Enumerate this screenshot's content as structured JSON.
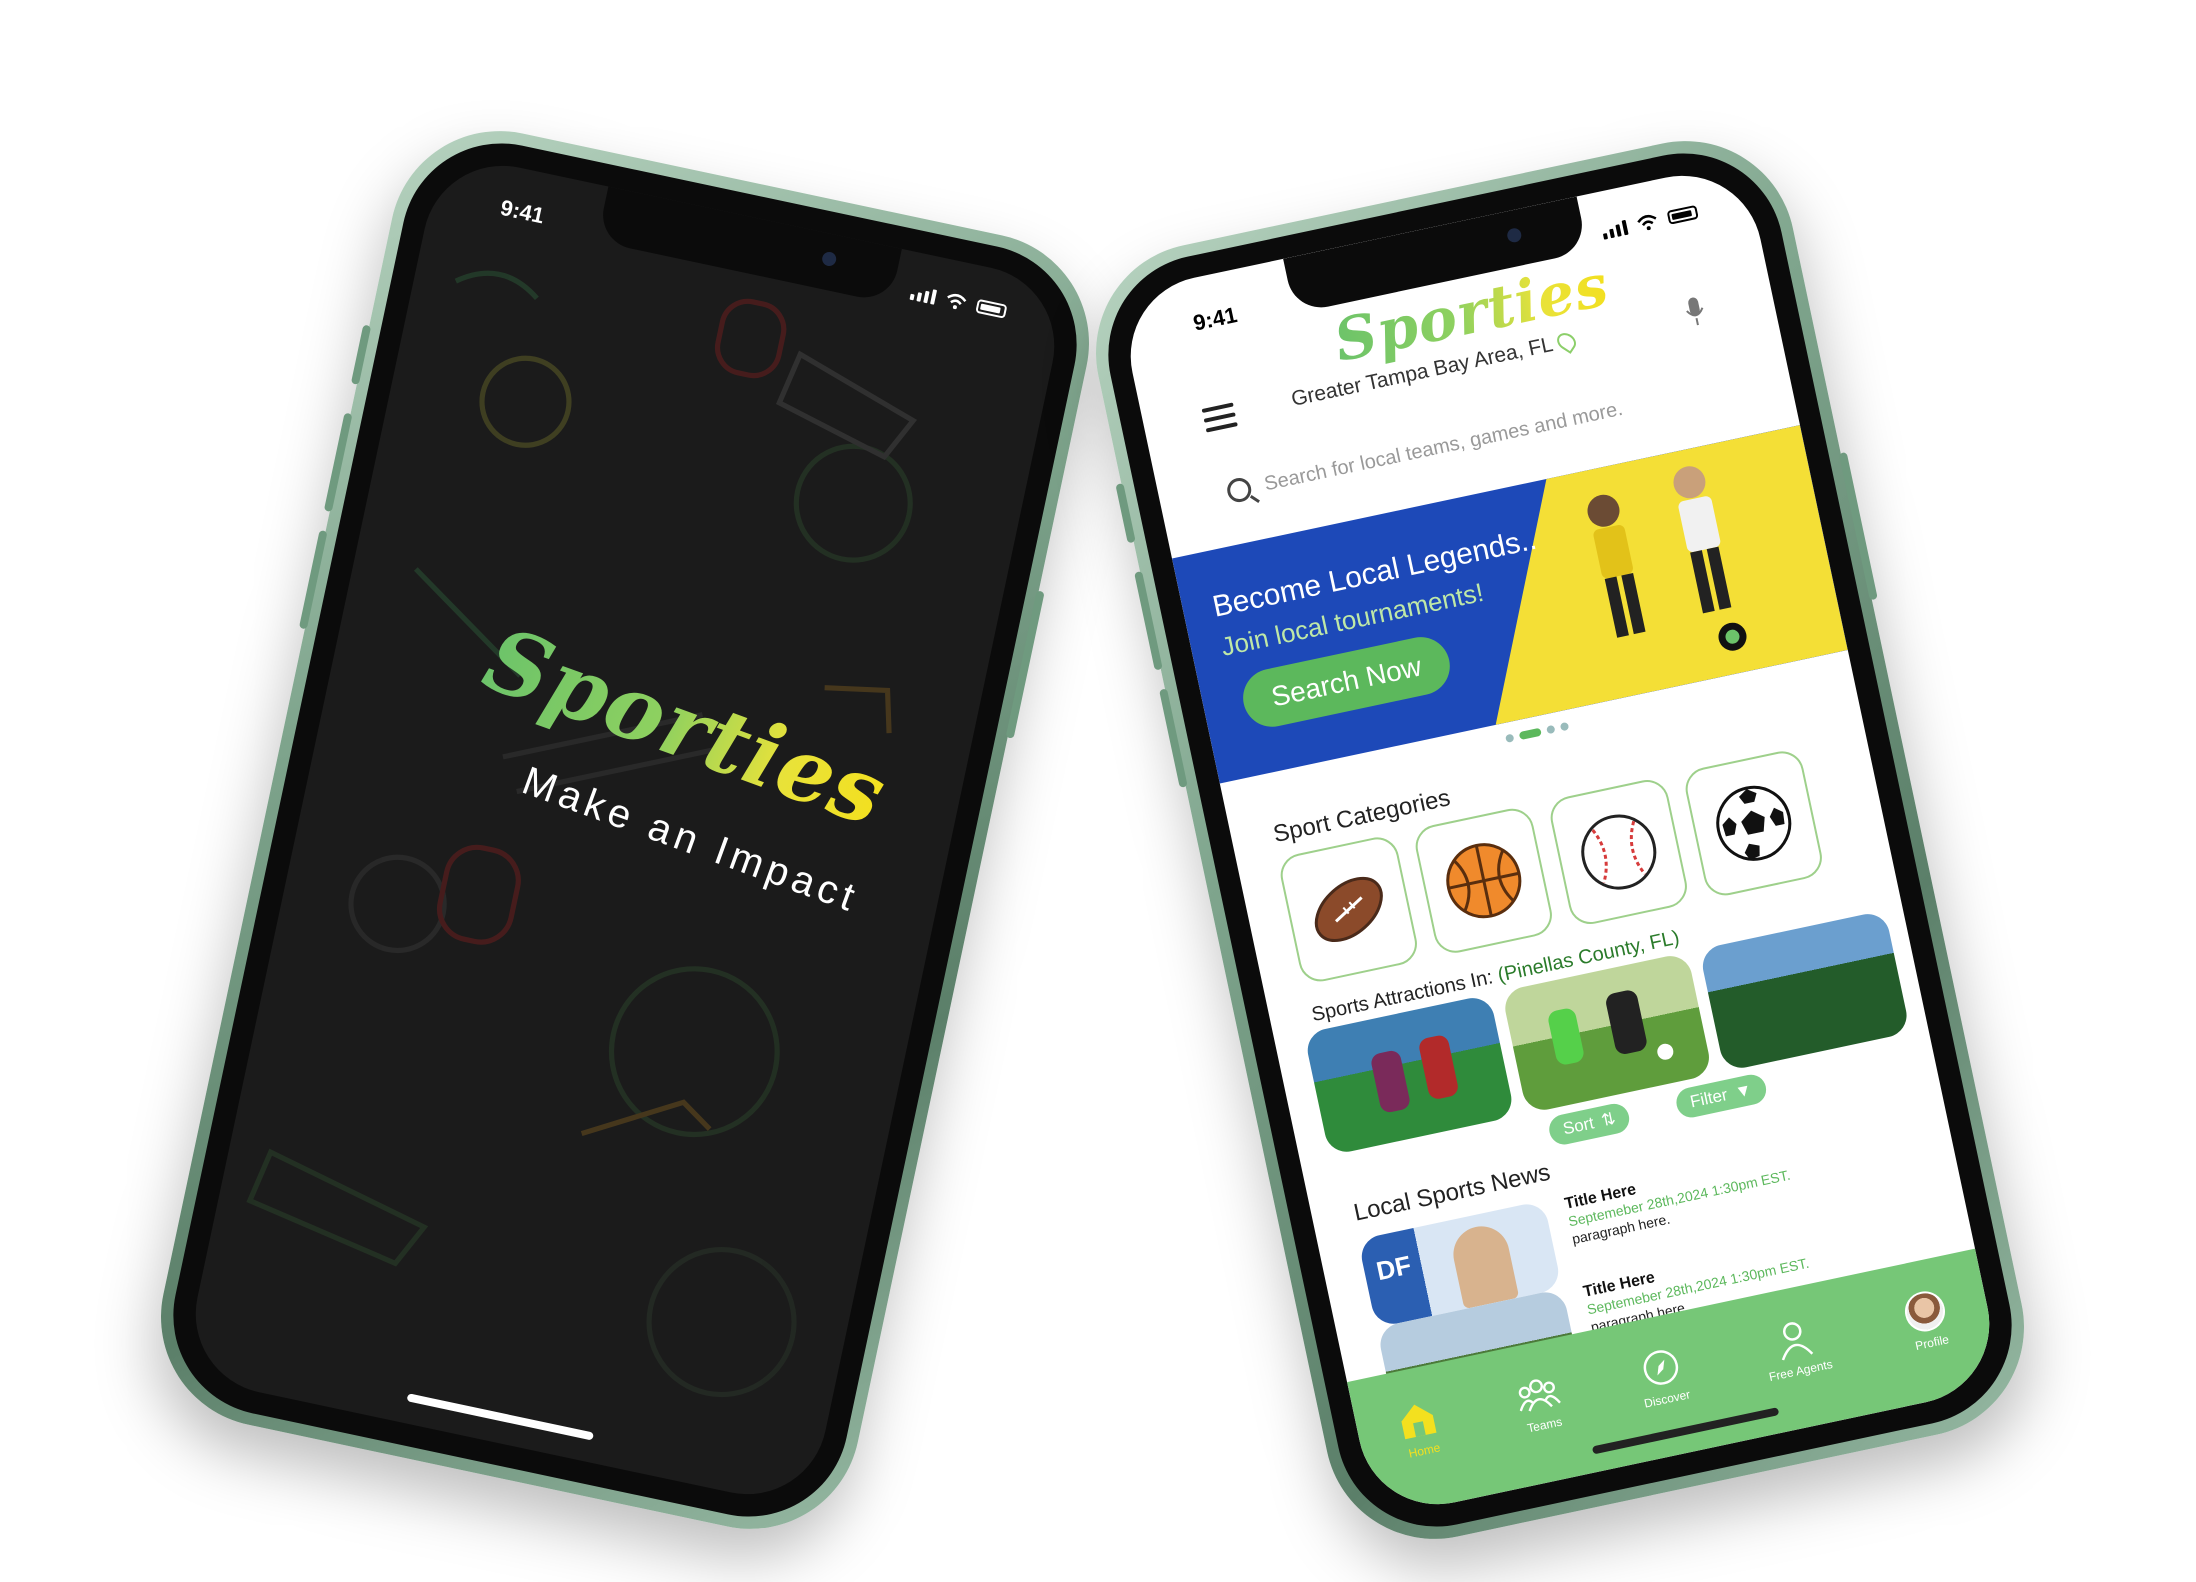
{
  "splash": {
    "status_time": "9:41",
    "logo_text": "Sporties",
    "tagline": "Make an Impact"
  },
  "home": {
    "status_time": "9:41",
    "logo_text": "Sporties",
    "location": "Greater Tampa Bay Area, FL",
    "search_placeholder": "Search for local teams, games and more.",
    "banner": {
      "title": "Become Local Legends..",
      "subtitle": "Join local tournaments!",
      "cta": "Search Now"
    },
    "categories_title": "Sport Categories",
    "categories": [
      "football-icon",
      "basketball-icon",
      "baseball-icon",
      "soccer-ball-icon"
    ],
    "attractions_title": "Sports Attractions In:",
    "attractions_location": "(Pinellas County, FL)",
    "sort_label": "Sort",
    "filter_label": "Filter",
    "news_title": "Local Sports News",
    "news": [
      {
        "title": "Title Here",
        "date": "Septemeber 28th,2024 1:30pm EST.",
        "body": "paragraph here."
      },
      {
        "title": "Title Here",
        "date": "Septemeber 28th,2024 1:30pm EST.",
        "body": "paragraph here."
      }
    ],
    "tabs": [
      {
        "label": "Home",
        "icon": "home-icon"
      },
      {
        "label": "Teams",
        "icon": "teams-icon"
      },
      {
        "label": "Discover",
        "icon": "compass-icon"
      },
      {
        "label": "Free Agents",
        "icon": "person-icon"
      },
      {
        "label": "Profile",
        "icon": "avatar"
      }
    ],
    "colors": {
      "brand_green": "#76c777",
      "banner_blue": "#1d49b8",
      "banner_yellow": "#f4df36"
    }
  }
}
